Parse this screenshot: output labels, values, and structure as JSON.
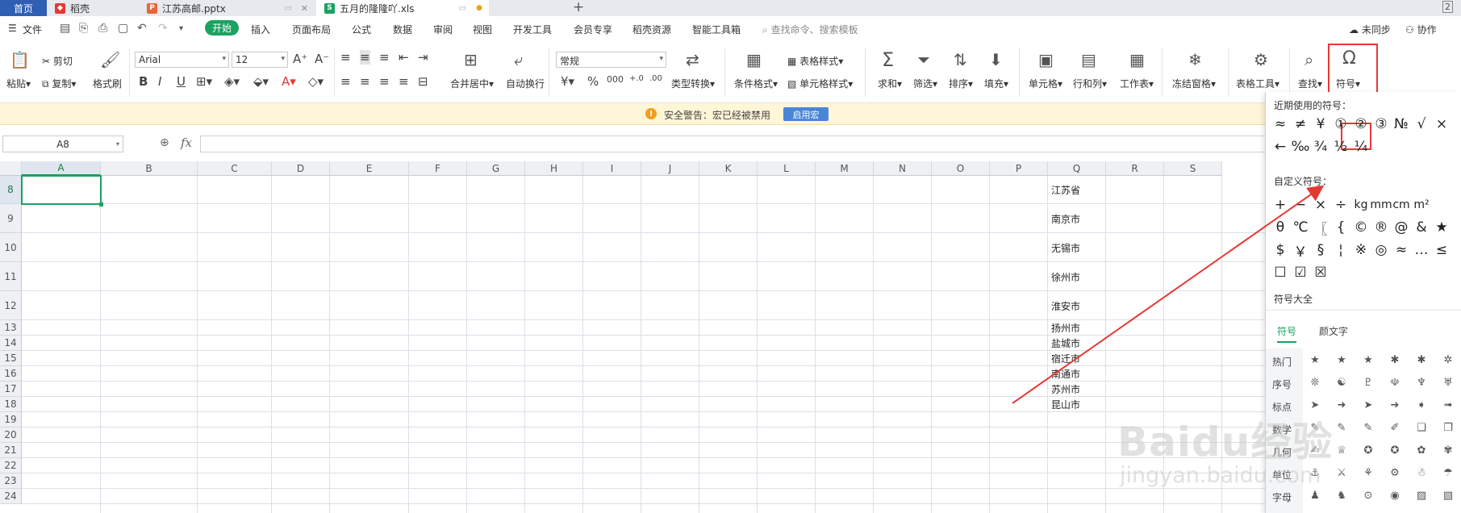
{
  "tabs": {
    "home": "首页",
    "docer": "稻壳",
    "pptx": "江苏高邮.pptx",
    "xls": "五月的隆隆吖.xls",
    "add": "+",
    "page_badge": "2"
  },
  "menu": {
    "file": "文件",
    "start": "开始",
    "items": [
      "插入",
      "页面布局",
      "公式",
      "数据",
      "审阅",
      "视图",
      "开发工具",
      "会员专享",
      "稻壳资源",
      "智能工具箱"
    ],
    "search": "查找命令、搜索模板",
    "sync": "未同步",
    "collab": "协作"
  },
  "ribbon": {
    "paste": "粘贴",
    "cut": "剪切",
    "copy": "复制",
    "format_painter": "格式刷",
    "font_name": "Arial",
    "font_size": "12",
    "number_format": "常规",
    "merge_center": "合并居中",
    "wrap_text": "自动换行",
    "type_convert": "类型转换",
    "cond_format": "条件格式",
    "table_style": "表格样式",
    "cell_style": "单元格样式",
    "sum": "求和",
    "filter": "筛选",
    "sort": "排序",
    "fill": "填充",
    "cell": "单元格",
    "row_col": "行和列",
    "worksheet": "工作表",
    "freeze": "冻结窗格",
    "table_tools": "表格工具",
    "find": "查找",
    "symbol": "符号"
  },
  "security": {
    "text": "安全警告：宏已经被禁用",
    "button": "启用宏"
  },
  "formula_bar": {
    "name_box": "A8",
    "fx": "fx",
    "value": ""
  },
  "grid": {
    "columns": [
      "A",
      "B",
      "C",
      "D",
      "E",
      "F",
      "G",
      "H",
      "I",
      "J",
      "K",
      "L",
      "M",
      "N",
      "O",
      "P",
      "Q",
      "R",
      "S"
    ],
    "rows": [
      "8",
      "9",
      "10",
      "11",
      "12",
      "13",
      "14",
      "15",
      "16",
      "17",
      "18",
      "19",
      "20",
      "21",
      "22",
      "23",
      "24"
    ],
    "q_values": [
      "江苏省",
      "南京市",
      "无锡市",
      "徐州市",
      "淮安市",
      "扬州市",
      "盐城市",
      "宿迁市",
      "南通市",
      "苏州市",
      "昆山市"
    ]
  },
  "symbol_panel": {
    "recent_title": "近期使用的符号：",
    "recent_row1": [
      "≈",
      "≠",
      "¥",
      "①",
      "②",
      "③",
      "№",
      "√",
      "×"
    ],
    "recent_row2": [
      "←",
      "‰",
      "¾",
      "½",
      "¼"
    ],
    "custom_title": "自定义符号：",
    "custom_row1": [
      "+",
      "−",
      "×",
      "÷",
      "kg",
      "mm",
      "cm",
      "m²"
    ],
    "custom_row2": [
      "θ",
      "℃",
      "〖",
      "{",
      "©",
      "®",
      "@",
      "&",
      "★"
    ],
    "custom_row3": [
      "$",
      "￥",
      "§",
      "¦",
      "※",
      "◎",
      "≈",
      "…",
      "≤"
    ],
    "custom_row4": [
      "☐",
      "☑",
      "☒"
    ],
    "all_title": "符号大全",
    "tab_symbols": "符号",
    "tab_kaomoji": "颜文字",
    "categories": [
      "热门",
      "序号",
      "标点",
      "数学",
      "几何",
      "单位",
      "字母"
    ],
    "sample_row1": [
      "★",
      "★",
      "★",
      "✱",
      "✱",
      "✲"
    ],
    "sample_row2": [
      "❊",
      "☯",
      "♇",
      "☫",
      "♆",
      "♅"
    ],
    "sample_row3": [
      "➤",
      "➜",
      "➤",
      "➔",
      "➧",
      "➟"
    ],
    "sample_row4": [
      "✎",
      "✎",
      "✎",
      "✐",
      "❏",
      "❐"
    ],
    "sample_row5": [
      "✍",
      "♕",
      "✪",
      "✪",
      "✿",
      "✾"
    ],
    "sample_row6": [
      "⚓",
      "⚔",
      "⚘",
      "⚙",
      "☃",
      "☂"
    ],
    "sample_row7": [
      "♟",
      "♞",
      "⊙",
      "◉",
      "▨",
      "▧"
    ]
  },
  "watermark": {
    "text": "Baidu经验",
    "url": "jingyan.baidu.com"
  },
  "colors": {
    "accent_green": "#1aa260",
    "highlight_red": "#e53935",
    "tab_blue": "#2f5fb3"
  }
}
